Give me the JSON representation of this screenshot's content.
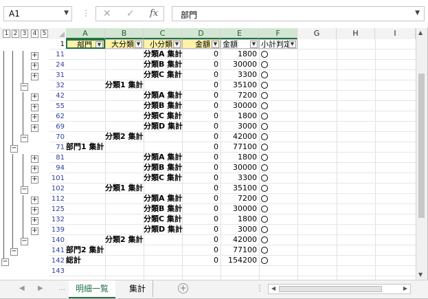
{
  "formula_bar": {
    "name_box": "A1",
    "cancel_glyph": "✕",
    "enter_glyph": "✓",
    "fx_glyph": "fx",
    "content": "部門"
  },
  "outline_levels": [
    "1",
    "2",
    "3",
    "4",
    "5"
  ],
  "columns": [
    "A",
    "B",
    "C",
    "D",
    "E",
    "F",
    "G",
    "H",
    "I"
  ],
  "header_row": {
    "row_num": "1",
    "A": "部門",
    "B": "大分類",
    "C": "小分類",
    "D": "金額",
    "E": "金額",
    "F": "小計判定"
  },
  "rows": [
    {
      "n": "11",
      "A": "",
      "B": "",
      "C": "分類A 集計",
      "D": "0",
      "E": "1800",
      "F": "circle"
    },
    {
      "n": "24",
      "A": "",
      "B": "",
      "C": "分類B 集計",
      "D": "0",
      "E": "30000",
      "F": "circle"
    },
    {
      "n": "31",
      "A": "",
      "B": "",
      "C": "分類C 集計",
      "D": "0",
      "E": "3300",
      "F": "circle"
    },
    {
      "n": "32",
      "A": "",
      "B": "分類1 集計",
      "C": "",
      "D": "0",
      "E": "35100",
      "F": "circle"
    },
    {
      "n": "42",
      "A": "",
      "B": "",
      "C": "分類A 集計",
      "D": "0",
      "E": "7200",
      "F": "circle"
    },
    {
      "n": "55",
      "A": "",
      "B": "",
      "C": "分類B 集計",
      "D": "0",
      "E": "30000",
      "F": "circle"
    },
    {
      "n": "62",
      "A": "",
      "B": "",
      "C": "分類C 集計",
      "D": "0",
      "E": "1800",
      "F": "circle"
    },
    {
      "n": "69",
      "A": "",
      "B": "",
      "C": "分類D 集計",
      "D": "0",
      "E": "3000",
      "F": "circle"
    },
    {
      "n": "70",
      "A": "",
      "B": "分類2 集計",
      "C": "",
      "D": "0",
      "E": "42000",
      "F": "circle"
    },
    {
      "n": "71",
      "A": "部門1 集計",
      "B": "",
      "C": "",
      "D": "0",
      "E": "77100",
      "F": "circle"
    },
    {
      "n": "81",
      "A": "",
      "B": "",
      "C": "分類A 集計",
      "D": "0",
      "E": "1800",
      "F": "circle"
    },
    {
      "n": "94",
      "A": "",
      "B": "",
      "C": "分類B 集計",
      "D": "0",
      "E": "30000",
      "F": "circle"
    },
    {
      "n": "101",
      "A": "",
      "B": "",
      "C": "分類C 集計",
      "D": "0",
      "E": "3300",
      "F": "circle"
    },
    {
      "n": "102",
      "A": "",
      "B": "分類1 集計",
      "C": "",
      "D": "0",
      "E": "35100",
      "F": "circle"
    },
    {
      "n": "112",
      "A": "",
      "B": "",
      "C": "分類A 集計",
      "D": "0",
      "E": "7200",
      "F": "circle"
    },
    {
      "n": "125",
      "A": "",
      "B": "",
      "C": "分類B 集計",
      "D": "0",
      "E": "30000",
      "F": "circle"
    },
    {
      "n": "132",
      "A": "",
      "B": "",
      "C": "分類C 集計",
      "D": "0",
      "E": "1800",
      "F": "circle"
    },
    {
      "n": "139",
      "A": "",
      "B": "",
      "C": "分類D 集計",
      "D": "0",
      "E": "3000",
      "F": "circle"
    },
    {
      "n": "140",
      "A": "",
      "B": "分類2 集計",
      "C": "",
      "D": "0",
      "E": "42000",
      "F": "circle"
    },
    {
      "n": "141",
      "A": "部門2 集計",
      "B": "",
      "C": "",
      "D": "0",
      "E": "77100",
      "F": "circle"
    },
    {
      "n": "142",
      "A": "総計",
      "B": "",
      "C": "",
      "D": "0",
      "E": "154200",
      "F": "circle"
    },
    {
      "n": "143",
      "A": "",
      "B": "",
      "C": "",
      "D": "",
      "E": "",
      "F": ""
    }
  ],
  "sheet_tabs": [
    "明細一覧",
    "集計"
  ],
  "active_tab": "明細一覧",
  "add_tab_glyph": "+",
  "accent_color": "#217346"
}
